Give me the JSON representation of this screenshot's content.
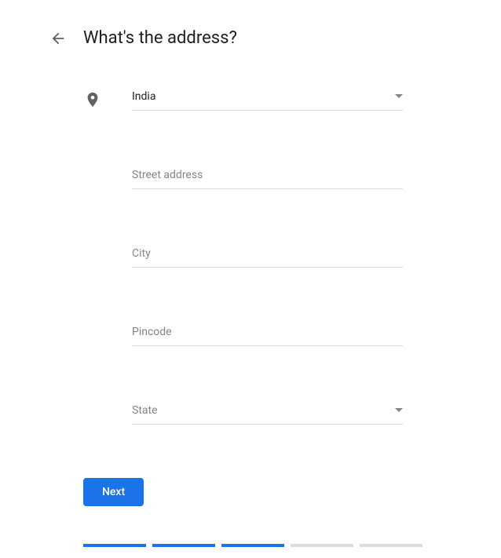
{
  "header": {
    "title": "What's the address?"
  },
  "form": {
    "country": {
      "value": "India"
    },
    "street": {
      "placeholder": "Street address"
    },
    "city": {
      "placeholder": "City"
    },
    "pincode": {
      "placeholder": "Pincode"
    },
    "state": {
      "placeholder": "State"
    }
  },
  "actions": {
    "next_label": "Next"
  },
  "progress": {
    "completed": 3,
    "total": 5
  }
}
